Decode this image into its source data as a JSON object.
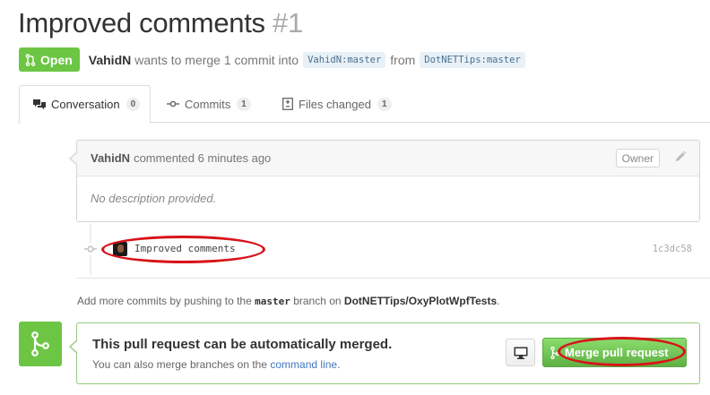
{
  "pull_request": {
    "title": "Improved comments",
    "number": "#1",
    "state": "Open",
    "author": "VahidN",
    "summary_text": "wants to merge 1 commit into",
    "base_branch": "VahidN:master",
    "from_text": "from",
    "head_branch": "DotNETTips:master"
  },
  "tabs": [
    {
      "label": "Conversation",
      "count": "0",
      "icon": "comment-discussion-icon",
      "selected": true
    },
    {
      "label": "Commits",
      "count": "1",
      "icon": "git-commit-icon",
      "selected": false
    },
    {
      "label": "Files changed",
      "count": "1",
      "icon": "diff-icon",
      "selected": false
    }
  ],
  "comment": {
    "author": "VahidN",
    "action_time": "commented 6 minutes ago",
    "role_label": "Owner",
    "body": "No description provided."
  },
  "commit": {
    "message": "Improved comments",
    "sha": "1c3dc58"
  },
  "push_note": {
    "prefix": "Add more commits by pushing to the",
    "branch": "master",
    "middle": "branch on",
    "repo": "DotNETTips/OxyPlotWpfTests",
    "suffix": "."
  },
  "merge": {
    "heading": "This pull request can be automatically merged.",
    "sub_prefix": "You can also merge branches on the",
    "sub_link": "command line",
    "sub_suffix": ".",
    "button_label": "Merge pull request"
  },
  "colors": {
    "open_green": "#6cc644",
    "link_blue": "#4078c0",
    "annotation_red": "#d8131a"
  }
}
